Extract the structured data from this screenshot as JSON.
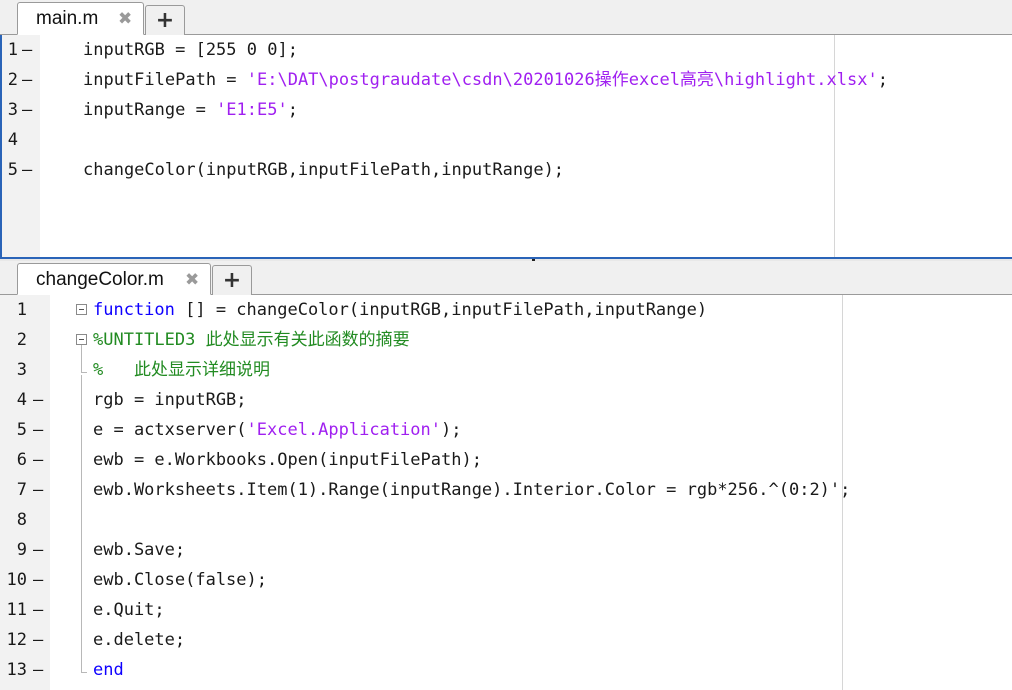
{
  "top_editor": {
    "tab_label": "main.m",
    "close_glyph": "✖",
    "add_glyph": "+",
    "lines": [
      {
        "num": "1",
        "dash": "—",
        "segments": [
          {
            "t": "inputRGB = [255 0 0];",
            "c": "plain"
          }
        ]
      },
      {
        "num": "2",
        "dash": "—",
        "segments": [
          {
            "t": "inputFilePath = ",
            "c": "plain"
          },
          {
            "t": "'E:\\DAT\\postgraudate\\csdn\\20201026操作excel高亮\\highlight.xlsx'",
            "c": "str"
          },
          {
            "t": ";",
            "c": "plain"
          }
        ]
      },
      {
        "num": "3",
        "dash": "—",
        "segments": [
          {
            "t": "inputRange = ",
            "c": "plain"
          },
          {
            "t": "'E1:E5'",
            "c": "str"
          },
          {
            "t": ";",
            "c": "plain"
          }
        ]
      },
      {
        "num": "4",
        "dash": "",
        "segments": []
      },
      {
        "num": "5",
        "dash": "—",
        "segments": [
          {
            "t": "changeColor(inputRGB,inputFilePath,inputRange);",
            "c": "plain"
          }
        ]
      }
    ]
  },
  "bottom_editor": {
    "tab_label": "changeColor.m",
    "close_glyph": "✖",
    "add_glyph": "+",
    "lines": [
      {
        "num": "1",
        "dash": "",
        "segments": [
          {
            "t": "function",
            "c": "kw"
          },
          {
            "t": " [] = changeColor(inputRGB,inputFilePath,inputRange)",
            "c": "plain"
          }
        ]
      },
      {
        "num": "2",
        "dash": "",
        "segments": [
          {
            "t": "%UNTITLED3 此处显示有关此函数的摘要",
            "c": "cm"
          }
        ]
      },
      {
        "num": "3",
        "dash": "",
        "segments": [
          {
            "t": "%   此处显示详细说明",
            "c": "cm"
          }
        ]
      },
      {
        "num": "4",
        "dash": "—",
        "segments": [
          {
            "t": "rgb = inputRGB;",
            "c": "plain"
          }
        ]
      },
      {
        "num": "5",
        "dash": "—",
        "segments": [
          {
            "t": "e = actxserver(",
            "c": "plain"
          },
          {
            "t": "'Excel.Application'",
            "c": "str"
          },
          {
            "t": ");",
            "c": "plain"
          }
        ]
      },
      {
        "num": "6",
        "dash": "—",
        "segments": [
          {
            "t": "ewb = e.Workbooks.Open(inputFilePath);",
            "c": "plain"
          }
        ]
      },
      {
        "num": "7",
        "dash": "—",
        "segments": [
          {
            "t": "ewb.Worksheets.Item(1).Range(inputRange).Interior.Color = rgb*256.^(0:2)';",
            "c": "plain"
          }
        ]
      },
      {
        "num": "8",
        "dash": "",
        "segments": []
      },
      {
        "num": "9",
        "dash": "—",
        "segments": [
          {
            "t": "ewb.Save;",
            "c": "plain"
          }
        ]
      },
      {
        "num": "10",
        "dash": "—",
        "segments": [
          {
            "t": "ewb.Close(false);",
            "c": "plain"
          }
        ]
      },
      {
        "num": "11",
        "dash": "—",
        "segments": [
          {
            "t": "e.Quit;",
            "c": "plain"
          }
        ]
      },
      {
        "num": "12",
        "dash": "—",
        "segments": [
          {
            "t": "e.delete;",
            "c": "plain"
          }
        ]
      },
      {
        "num": "13",
        "dash": "—",
        "segments": [
          {
            "t": "end",
            "c": "kw"
          }
        ]
      }
    ]
  },
  "colors": {
    "keyword": "#0e00ff",
    "string": "#a020f0",
    "comment": "#228b22",
    "active_border": "#2a64b8"
  }
}
